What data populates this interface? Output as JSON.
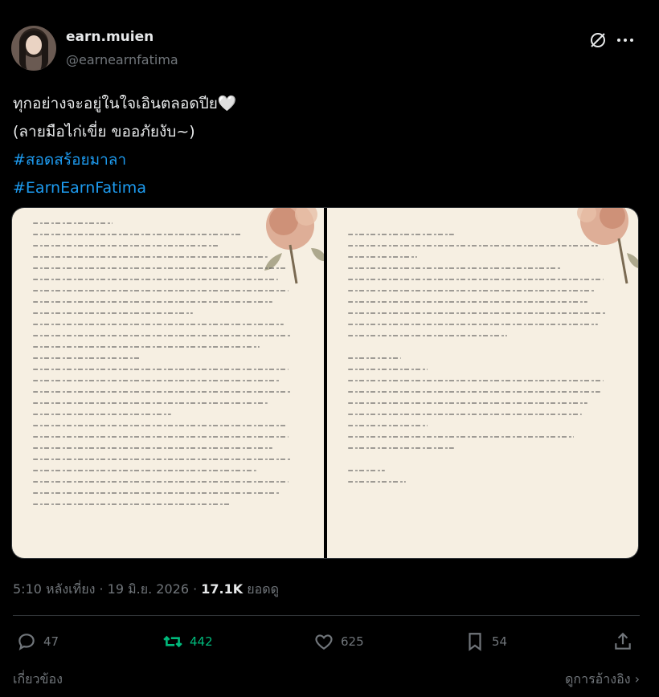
{
  "user": {
    "name": "earn.muien",
    "handle": "@earnearnfatima"
  },
  "post": {
    "line1": "ทุกอย่างจะอยู่ในใจเอินตลอดปีย🤍",
    "line2": "(ลายมือไก่เขี่ย ขออภัยงับ~)",
    "hashtag1": "#สอดสร้อยมาลา",
    "hashtag2": "#EarnEarnFatima"
  },
  "meta": {
    "time": "5:10 หลังเที่ยง",
    "date": "19 มิ.ย. 2026",
    "views_count": "17.1K",
    "views_label": "ยอดดู"
  },
  "actions": {
    "replies": "47",
    "reposts": "442",
    "likes": "625",
    "bookmarks": "54"
  },
  "footer": {
    "related": "เกี่ยวข้อง",
    "quotes": "ดูการอ้างอิง"
  },
  "icons": [
    "grok-icon",
    "more-icon",
    "reply-icon",
    "retweet-icon",
    "like-icon",
    "bookmark-icon",
    "share-icon",
    "chevron-right-icon"
  ],
  "colors": {
    "background": "#000000",
    "text": "#e7e9ea",
    "muted": "#71767b",
    "link": "#1d9bf0",
    "repost_active": "#00ba7c",
    "paper": "#f6efe2"
  }
}
